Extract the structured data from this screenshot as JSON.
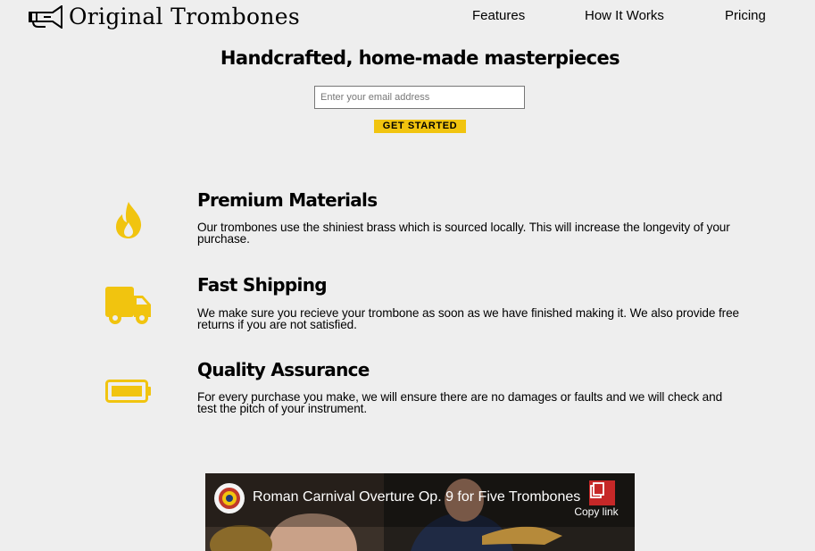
{
  "brand": {
    "name": "Original Trombones",
    "icon": "trombone-icon"
  },
  "nav": {
    "items": [
      "Features",
      "How It Works",
      "Pricing"
    ]
  },
  "hero": {
    "title": "Handcrafted, home-made masterpieces",
    "email_placeholder": "Enter your email address",
    "cta_label": "GET STARTED"
  },
  "features": [
    {
      "icon": "fire-icon",
      "title": "Premium Materials",
      "description": "Our trombones use the shiniest brass which is sourced locally. This will increase the longevity of your purchase."
    },
    {
      "icon": "truck-icon",
      "title": "Fast Shipping",
      "description": "We make sure you recieve your trombone as soon as we have finished making it. We also provide free returns if you are not satisfied."
    },
    {
      "icon": "battery-full-icon",
      "title": "Quality Assurance",
      "description": "For every purchase you make, we will ensure there are no damages or faults and we will check and test the pitch of your instrument."
    }
  ],
  "video": {
    "title": "Roman Carnival Overture Op. 9 for Five Trombones",
    "copy_link_label": "Copy link"
  },
  "colors": {
    "background": "#eeeeee",
    "accent": "#f1c40f"
  }
}
